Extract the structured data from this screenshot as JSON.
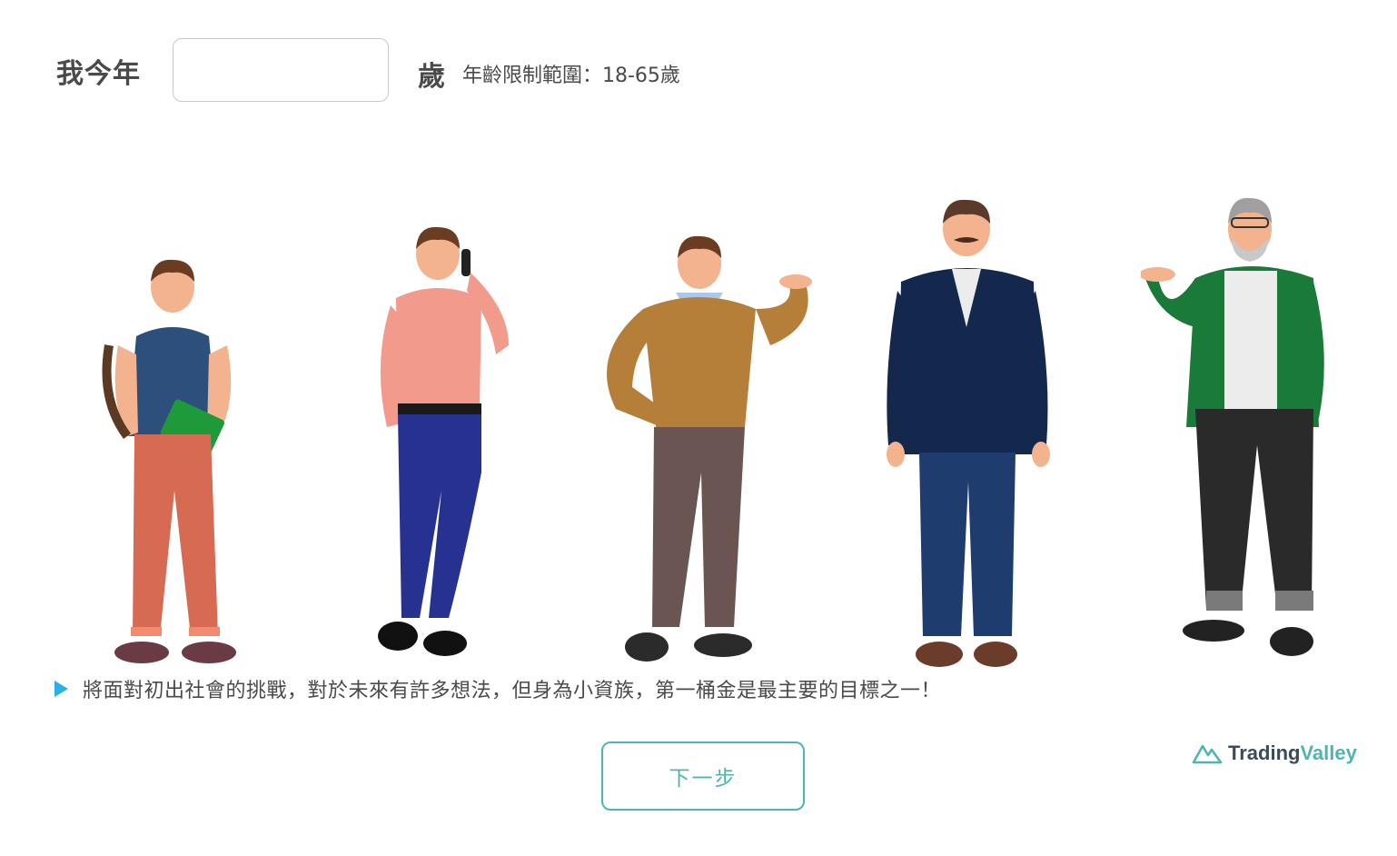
{
  "age": {
    "label": "我今年",
    "input_value": "",
    "unit": "歲",
    "hint": "年齡限制範圍：18-65歲"
  },
  "figures": [
    {
      "name": "student",
      "shirt": "#2c4f7c",
      "pants": "#d76a52",
      "shoes": "#6a3a45",
      "skin": "#f2b38e",
      "hair": "#6a3c22"
    },
    {
      "name": "young-professional",
      "shirt": "#f29a8c",
      "pants": "#27318f",
      "shoes": "#111111",
      "skin": "#f2b38e",
      "hair": "#6a3c22"
    },
    {
      "name": "middle-aged",
      "shirt": "#b57f3a",
      "pants": "#6a5553",
      "shoes": "#2b2b2b",
      "skin": "#f2b38e",
      "hair": "#6a3c22"
    },
    {
      "name": "senior-professional",
      "shirt": "#14284e",
      "pants": "#1f3c6e",
      "shoes": "#6b3c2a",
      "skin": "#f2b38e",
      "hair": "#5a3a28"
    },
    {
      "name": "retiree",
      "shirt": "#1a7a3a",
      "pants": "#2a2a2a",
      "shoes": "#222222",
      "skin": "#f2b38e",
      "hair": "#a0a0a0"
    }
  ],
  "description": "將面對初出社會的挑戰，對於未來有許多想法，但身為小資族，第一桶金是最主要的目標之一！",
  "next_button": "下一步",
  "brand": {
    "part1": "Trading",
    "part2": "Valley"
  },
  "colors": {
    "accent": "#4fb5b0",
    "triangle": "#2ab0e4",
    "text": "#4a4a4a"
  }
}
